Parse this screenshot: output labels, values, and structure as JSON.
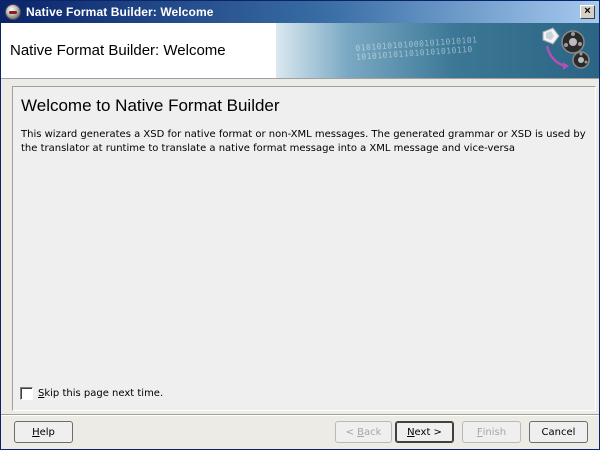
{
  "window": {
    "title": "Native Format Builder: Welcome",
    "close_glyph": "×"
  },
  "banner": {
    "title": "Native Format Builder: Welcome",
    "bits_text": "01010101010001011010101\n1010101011010101010110",
    "art_icon": "gears-icon"
  },
  "content": {
    "heading": "Welcome to Native Format Builder",
    "description": "This wizard generates a XSD for native format or non-XML messages. The generated grammar or XSD is used by the translator at runtime to translate a native format message into a XML message and vice-versa",
    "skip_label_mnemonic": "S",
    "skip_label_rest": "kip this page next time.",
    "skip_checked": false
  },
  "buttons": {
    "help": {
      "mn": "H",
      "rest": "elp"
    },
    "back": {
      "pre": "< ",
      "mn": "B",
      "rest": "ack"
    },
    "next": {
      "mn": "N",
      "rest": "ext >"
    },
    "finish": {
      "mn": "F",
      "rest": "inish"
    },
    "cancel": {
      "label": "Cancel"
    }
  },
  "colors": {
    "titlebar_start": "#0a246a",
    "titlebar_end": "#a6caf0",
    "banner_art": "#3c7896",
    "panel": "#efefef"
  }
}
